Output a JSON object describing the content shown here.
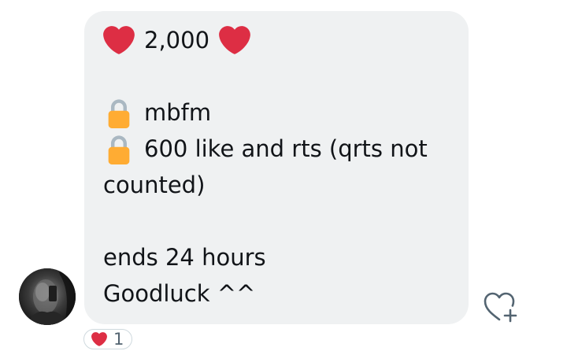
{
  "message": {
    "line1": "2,000",
    "line2": "mbfm",
    "line3": "600 like and rts (qrts not",
    "line4": "counted)",
    "line5": "ends 24 hours",
    "line6": "Goodluck ^^"
  },
  "reaction": {
    "count": "1"
  },
  "icons": {
    "heart": "red-heart-icon",
    "lock": "lock-icon",
    "add_reaction": "heart-plus-icon"
  },
  "colors": {
    "bubble": "#eff1f2",
    "heart": "#dd2e44",
    "lock_body": "#ffac33",
    "lock_shackle": "#aab8c2",
    "icon_outline": "#536471"
  }
}
